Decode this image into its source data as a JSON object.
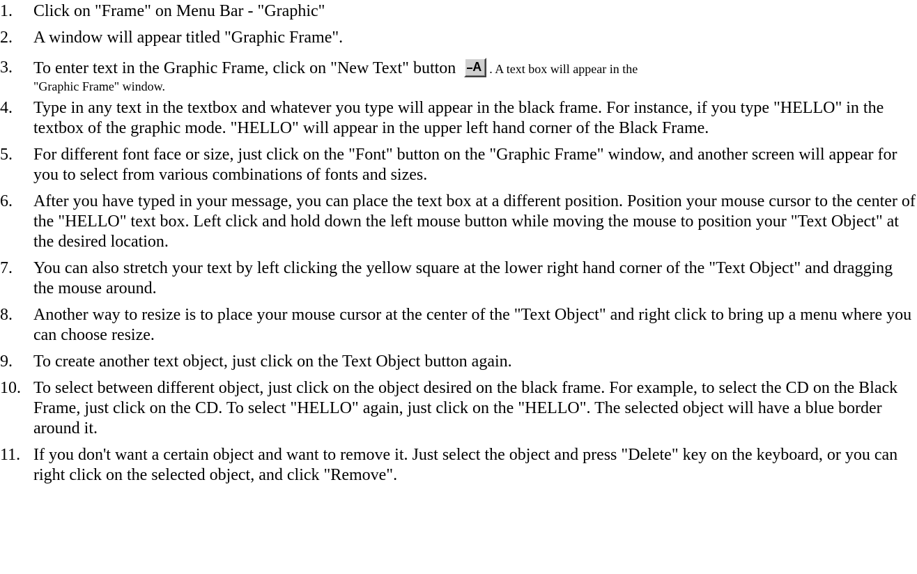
{
  "steps": [
    {
      "num": "1.",
      "text": "Click on \"Frame\" on Menu Bar - \"Graphic\""
    },
    {
      "num": "2.",
      "text": "A window will appear titled \"Graphic Frame\"."
    },
    {
      "num": "3.",
      "text_before": "To enter text in the Graphic Frame, click on \"New Text\" button",
      "icon": "new-text-button-icon",
      "text_after_a": ".",
      "text_after_b": " A text box will appear in the",
      "text_line2": "\"Graphic Frame\" window."
    },
    {
      "num": "4.",
      "text": "Type in any text in the textbox and whatever you type will appear in the black frame.  For instance, if you type \"HELLO\" in the textbox of the graphic mode. \"HELLO\" will appear in the upper left hand corner of the Black Frame."
    },
    {
      "num": "5.",
      "text": "For different font face or size, just click on the \"Font\" button on the \"Graphic Frame\" window, and another screen will appear for you to select from various combinations of fonts and sizes."
    },
    {
      "num": "6.",
      "text": "After you have typed in your message, you can place the text box at a different position. Position your mouse cursor to the center of the \"HELLO\" text box.  Left click and hold down the left mouse button while moving the mouse to position your \"Text Object\" at the desired location."
    },
    {
      "num": "7.",
      "text": "You can also stretch your text by left clicking the yellow square at the lower right hand corner of the \"Text Object\" and dragging the mouse around."
    },
    {
      "num": "8.",
      "text": "Another way to resize is to place your mouse cursor at the center of the \"Text Object\" and right click to bring up a menu where you can choose resize."
    },
    {
      "num": "9.",
      "text": "To create another text object, just click on the Text Object button again."
    },
    {
      "num": "10.",
      "text": "To select between different object, just click on the object desired on the black frame.  For example, to select the CD on the Black Frame, just click on the CD.  To select \"HELLO\" again, just click on the \"HELLO\".  The selected object will have a blue border around it."
    },
    {
      "num": "11.",
      "text": "If you don't want a certain object and want to remove it.  Just select the object and press \"Delete\" key on the keyboard, or you can right click on the selected object, and click \"Remove\"."
    }
  ],
  "icon_glyph": "A"
}
